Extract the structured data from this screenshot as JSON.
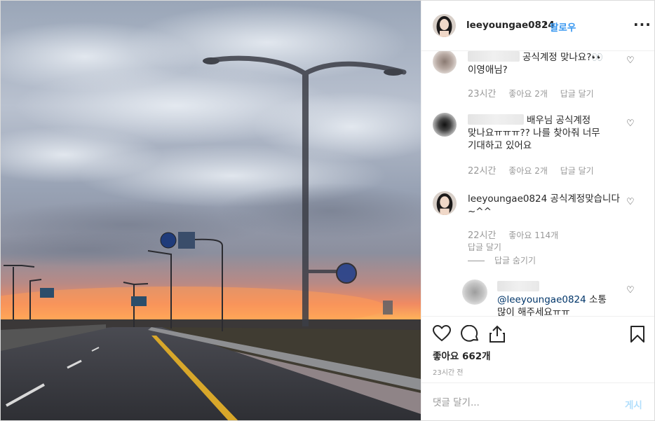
{
  "post": {
    "username": "leeyoungae0824",
    "separator": "•",
    "follow_label": "팔로우",
    "more_icon": "more-horizontal-icon"
  },
  "comments": [
    {
      "username_blurred": true,
      "text": "공식계정 맞나요?👀 이영애님?",
      "time": "23시간",
      "likes": "좋아요 2개",
      "reply_label": "답글 달기"
    },
    {
      "username_blurred": true,
      "text": "배우님 공식계정 맞나요ㅠㅠㅠ?? 나를 찾아줘 너무 기대하고 있어요",
      "time": "22시간",
      "likes": "좋아요 2개",
      "reply_label": "답글 달기"
    },
    {
      "username": "leeyoungae0824",
      "text": "공식계정맞습니다~^^",
      "time": "22시간",
      "likes": "좋아요 114개",
      "reply_label": "답글 달기",
      "hide_replies_label": "답글 숨기기"
    },
    {
      "username_blurred": true,
      "mention": "@leeyoungae0824",
      "text": "소통 많이 해주세요ㅠㅠ"
    }
  ],
  "actions": {
    "like_icon": "heart-outline-icon",
    "comment_icon": "comment-icon",
    "share_icon": "share-icon",
    "save_icon": "bookmark-icon"
  },
  "likes_label": "좋아요 662개",
  "time_ago": "23시간 전",
  "add_comment": {
    "placeholder": "댓글 달기...",
    "post_label": "게시"
  },
  "colors": {
    "follow": "#3897f0",
    "post_disabled": "#b2dffc",
    "meta": "#999999",
    "sunset": "#ff7a3c"
  }
}
